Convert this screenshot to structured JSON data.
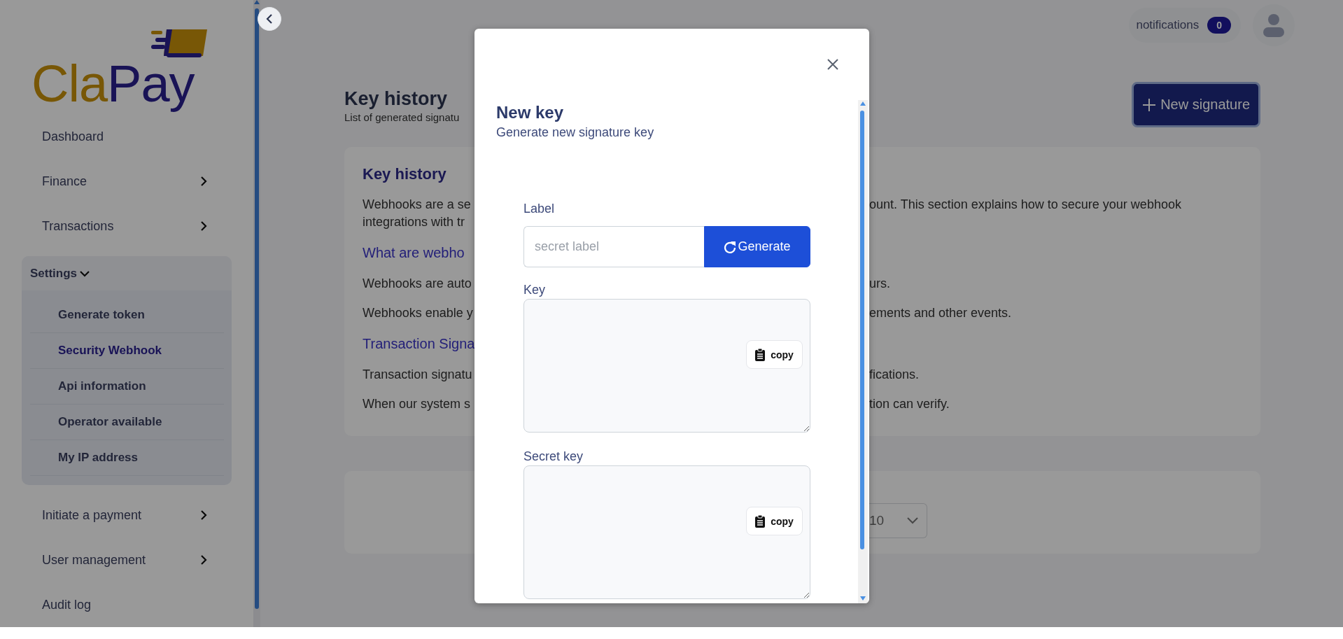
{
  "logo": {
    "text_1": "Cla",
    "text_2": "Pay"
  },
  "sidebar": {
    "items": [
      {
        "label": "Dashboard",
        "expandable": false
      },
      {
        "label": "Finance",
        "expandable": true,
        "expanded": false
      },
      {
        "label": "Transactions",
        "expandable": true,
        "expanded": false
      },
      {
        "label": "Settings",
        "expandable": true,
        "expanded": true,
        "children": [
          {
            "label": "Generate token",
            "selected": false
          },
          {
            "label": "Security Webhook",
            "selected": true
          },
          {
            "label": "Api information",
            "selected": false
          },
          {
            "label": "Operator available",
            "selected": false
          },
          {
            "label": "My IP address",
            "selected": false
          }
        ]
      },
      {
        "label": "Initiate a payment",
        "expandable": true,
        "expanded": false
      },
      {
        "label": "User management",
        "expandable": true,
        "expanded": false
      },
      {
        "label": "Audit log",
        "expandable": false
      }
    ]
  },
  "header": {
    "notifications": {
      "label": "notifications",
      "count": "0"
    }
  },
  "page": {
    "title": "Key history",
    "subtitle": "List of generated signatu",
    "new_button": "New signature"
  },
  "card": {
    "title": "Key history",
    "lines": [
      {
        "kind": "text",
        "left": "Webhooks are a se",
        "right": "ount. This section explains how to secure your webhook"
      },
      {
        "kind": "text",
        "left": "integrations with tr"
      },
      {
        "kind": "heading",
        "left": "What are webho"
      },
      {
        "kind": "text",
        "left": "Webhooks are auto",
        "right": "urs."
      },
      {
        "kind": "text",
        "left": "Webhooks enable y",
        "right": "ements and other events."
      },
      {
        "kind": "heading",
        "left": "Transaction Signa"
      },
      {
        "kind": "text",
        "left": "Transaction signatu",
        "right": "fications."
      },
      {
        "kind": "text",
        "left": "When our system s",
        "right": "tion can verify."
      }
    ]
  },
  "table_card": {
    "page_size": "10"
  },
  "modal": {
    "title": "New key",
    "subtitle": "Generate new signature key",
    "label_field": {
      "label": "Label",
      "placeholder": "secret label"
    },
    "generate_button": "Generate",
    "fields": [
      {
        "label": "Key",
        "copy_button": "copy"
      },
      {
        "label": "Secret key",
        "copy_button": "copy"
      }
    ]
  }
}
